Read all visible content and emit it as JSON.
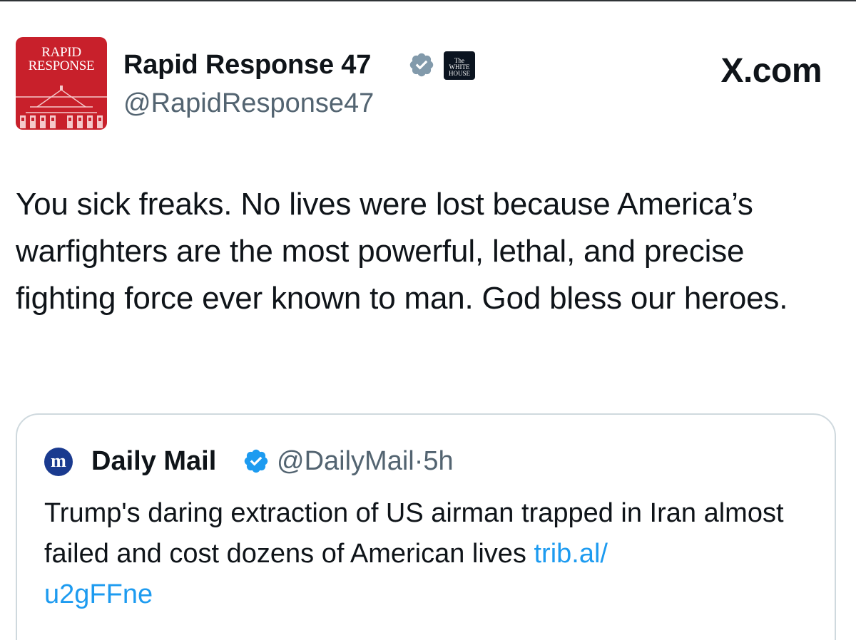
{
  "author": {
    "avatar_text": "RAPID\nRESPONSE",
    "display_name": "Rapid Response 47",
    "handle": "@RapidResponse47",
    "affiliate_badge_text": "The\nWHITE\nHOUSE",
    "verified_badge_color": "#829aab",
    "avatar_color": "#c8202b"
  },
  "site_label": "X.com",
  "post": {
    "text": "You sick freaks. No lives were lost because America’s warfighters are the most powerful, lethal, and precise fighting force ever known to man. God bless our heroes."
  },
  "quoted_post": {
    "avatar_letter": "m",
    "display_name": "Daily Mail",
    "handle": "@DailyMail",
    "separator": "·",
    "time": "5h",
    "text": "Trump's daring extraction of US airman trapped in Iran almost failed and cost dozens of American lives ",
    "link_line1": "trib.al/",
    "link_line2": "u2gFFne",
    "verified_badge_color": "#1d9bf0"
  },
  "colors": {
    "text_primary": "#0f1419",
    "text_secondary": "#536471",
    "link": "#1d9bf0",
    "card_border": "#cfd9de"
  }
}
